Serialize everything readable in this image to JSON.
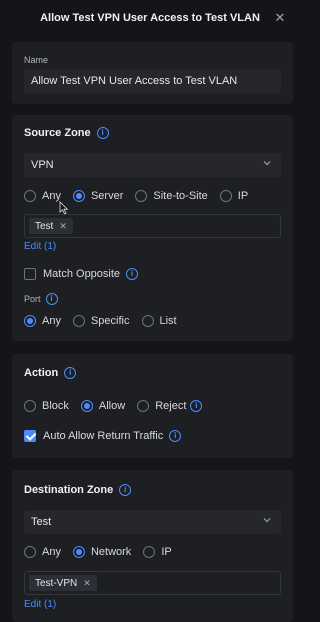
{
  "header": {
    "title": "Allow Test VPN User Access to Test VLAN"
  },
  "name_card": {
    "label": "Name",
    "value": "Allow Test VPN User Access to Test VLAN"
  },
  "source_zone": {
    "title": "Source Zone",
    "zone_value": "VPN",
    "options": [
      "Any",
      "Server",
      "Site-to-Site",
      "IP"
    ],
    "selected": "Server",
    "tags": [
      "Test"
    ],
    "edit_link": "Edit (1)",
    "match_opposite": "Match Opposite",
    "port_label": "Port",
    "port_options": [
      "Any",
      "Specific",
      "List"
    ],
    "port_selected": "Any"
  },
  "action": {
    "title": "Action",
    "options": [
      "Block",
      "Allow",
      "Reject"
    ],
    "selected": "Allow",
    "auto_allow": "Auto Allow Return Traffic"
  },
  "destination_zone": {
    "title": "Destination Zone",
    "zone_value": "Test",
    "options": [
      "Any",
      "Network",
      "IP"
    ],
    "selected": "Network",
    "tags": [
      "Test-VPN"
    ],
    "edit_link": "Edit (1)"
  },
  "colors": {
    "accent": "#4a8cff",
    "panel": "#1d1f23",
    "background": "#141518"
  }
}
